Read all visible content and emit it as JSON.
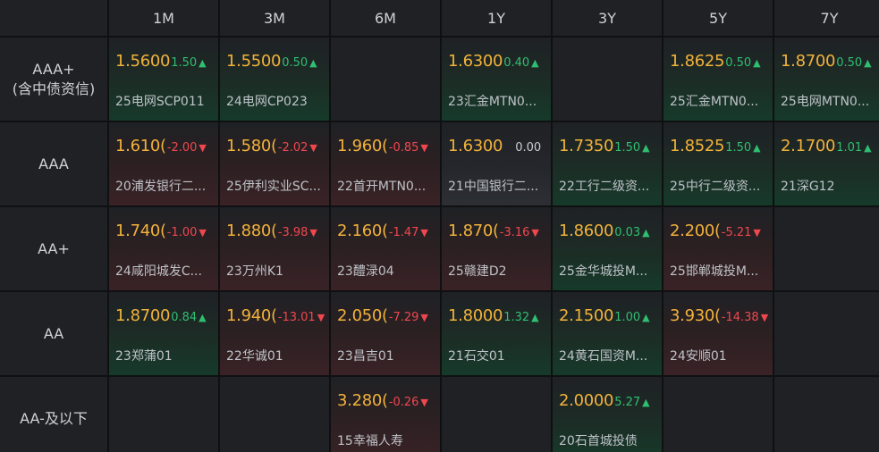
{
  "tenors": [
    "1M",
    "3M",
    "6M",
    "1Y",
    "3Y",
    "5Y",
    "7Y"
  ],
  "ratings": [
    {
      "label_lines": [
        "AAA+",
        "(含中债资信)"
      ]
    },
    {
      "label_lines": [
        "AAA"
      ]
    },
    {
      "label_lines": [
        "AA+"
      ]
    },
    {
      "label_lines": [
        "AA"
      ]
    },
    {
      "label_lines": [
        "AA-及以下"
      ]
    }
  ],
  "colors": {
    "up": "#2fbf71",
    "down": "#f0474f",
    "rate": "#f2b23a"
  },
  "cells": [
    [
      {
        "rate": "1.5600",
        "change": "1.50",
        "dir": "up",
        "bond": "25电网SCP011"
      },
      {
        "rate": "1.5500",
        "change": "0.50",
        "dir": "up",
        "bond": "24电网CP023"
      },
      null,
      {
        "rate": "1.6300",
        "change": "0.40",
        "dir": "up",
        "bond": "23汇金MTN0..."
      },
      null,
      {
        "rate": "1.8625",
        "change": "0.50",
        "dir": "up",
        "bond": "25汇金MTN0..."
      },
      {
        "rate": "1.8700",
        "change": "0.50",
        "dir": "up",
        "bond": "25电网MTN0..."
      }
    ],
    [
      {
        "rate": "1.610(",
        "change": "-2.00",
        "dir": "down",
        "bond": "20浦发银行二..."
      },
      {
        "rate": "1.580(",
        "change": "-2.02",
        "dir": "down",
        "bond": "25伊利实业SC..."
      },
      {
        "rate": "1.960(",
        "change": "-0.85",
        "dir": "down",
        "bond": "22首开MTN0..."
      },
      {
        "rate": "1.6300",
        "change": "0.00",
        "dir": "flat",
        "bond": "21中国银行二..."
      },
      {
        "rate": "1.7350",
        "change": "1.50",
        "dir": "up",
        "bond": "22工行二级资..."
      },
      {
        "rate": "1.8525",
        "change": "1.50",
        "dir": "up",
        "bond": "25中行二级资..."
      },
      {
        "rate": "2.1700",
        "change": "1.01",
        "dir": "up",
        "bond": "21深G12"
      }
    ],
    [
      {
        "rate": "1.740(",
        "change": "-1.00",
        "dir": "down",
        "bond": "24咸阳城发C..."
      },
      {
        "rate": "1.880(",
        "change": "-3.98",
        "dir": "down",
        "bond": "23万州K1"
      },
      {
        "rate": "2.160(",
        "change": "-1.47",
        "dir": "down",
        "bond": "23醴渌04"
      },
      {
        "rate": "1.870(",
        "change": "-3.16",
        "dir": "down",
        "bond": "25赣建D2"
      },
      {
        "rate": "1.8600",
        "change": "0.03",
        "dir": "up",
        "bond": "25金华城投M..."
      },
      {
        "rate": "2.200(",
        "change": "-5.21",
        "dir": "down",
        "bond": "25邯郸城投M..."
      },
      null
    ],
    [
      {
        "rate": "1.8700",
        "change": "0.84",
        "dir": "up",
        "bond": "23郑蒲01"
      },
      {
        "rate": "1.940(",
        "change": "-13.01",
        "dir": "down",
        "bond": "22华诚01"
      },
      {
        "rate": "2.050(",
        "change": "-7.29",
        "dir": "down",
        "bond": "23昌吉01"
      },
      {
        "rate": "1.8000",
        "change": "1.32",
        "dir": "up",
        "bond": "21石交01"
      },
      {
        "rate": "2.1500",
        "change": "1.00",
        "dir": "up",
        "bond": "24黄石国资M..."
      },
      {
        "rate": "3.930(",
        "change": "-14.38",
        "dir": "down",
        "bond": "24安顺01"
      },
      null
    ],
    [
      null,
      null,
      {
        "rate": "3.280(",
        "change": "-0.26",
        "dir": "down",
        "bond": "15幸福人寿"
      },
      null,
      {
        "rate": "2.0000",
        "change": "5.27",
        "dir": "up",
        "bond": "20石首城投债"
      },
      null,
      null
    ]
  ]
}
